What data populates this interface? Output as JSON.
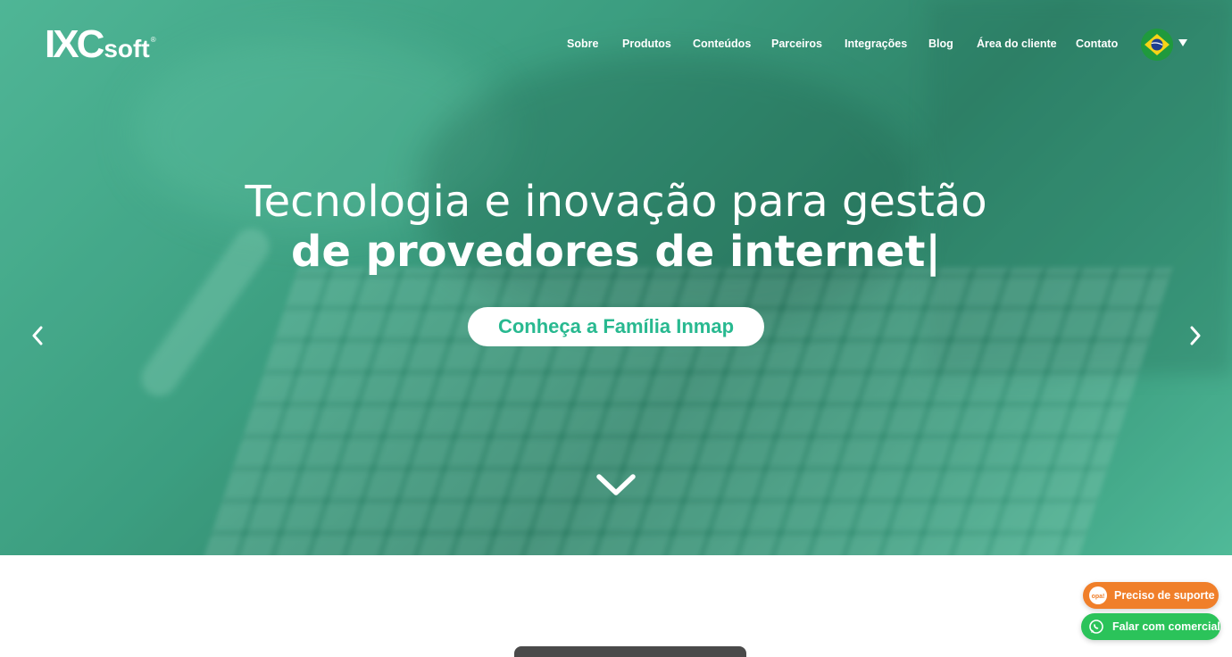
{
  "brand": {
    "logo_main": "IXC",
    "logo_soft": "soft",
    "logo_reg": "®"
  },
  "nav": {
    "items": [
      "Sobre",
      "Produtos",
      "Conteúdos",
      "Parceiros",
      "Integrações",
      "Blog",
      "Área do cliente",
      "Contato"
    ],
    "language_flag": "brazil-flag-icon"
  },
  "hero": {
    "headline_light": "Tecnologia e inovação para gestão",
    "headline_bold": "de provedores de internet|",
    "cta_label": "Conheça a Família Inmap"
  },
  "chat": {
    "support_label": "Preciso de suporte",
    "support_icon_text": "opa!",
    "sales_label": "Falar com comercial"
  },
  "colors": {
    "accent": "#28b990",
    "hero_tint": "#3f9c80",
    "support_button": "#f07f2a",
    "sales_button": "#2bc35a"
  },
  "icons": {
    "prev": "chevron-left-icon",
    "next": "chevron-right-icon",
    "scroll": "chevron-down-icon",
    "whatsapp": "whatsapp-icon"
  }
}
